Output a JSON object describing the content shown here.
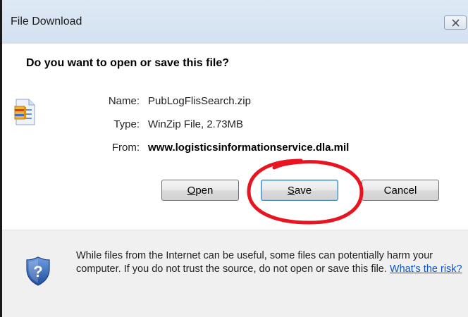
{
  "window": {
    "title": "File Download",
    "close_label": "close"
  },
  "dialog": {
    "question": "Do you want to open or save this file?",
    "file": {
      "icon": "winzip-file-icon",
      "name_label": "Name:",
      "name_value": "PubLogFlisSearch.zip",
      "type_label": "Type:",
      "type_value": "WinZip File, 2.73MB",
      "from_label": "From:",
      "from_value": "www.logisticsinformationservice.dla.mil"
    },
    "buttons": {
      "open_prefix": "",
      "open_underlined": "O",
      "open_rest": "pen",
      "save_prefix": "",
      "save_underlined": "S",
      "save_rest": "ave",
      "cancel_label": "Cancel"
    },
    "annotation": {
      "shape": "hand-drawn ellipse",
      "color": "#e8141f",
      "target": "Save"
    }
  },
  "footer": {
    "icon": "shield-question-icon",
    "warning_text": "While files from the Internet can be useful, some files can potentially harm your computer. If you do not trust the source, do not open or save this file.",
    "risk_link": "What's the risk?"
  },
  "colors": {
    "titlebar": "#d8e4f2",
    "footer_bg": "#f0f0f0",
    "link": "#0a56c8",
    "annotation": "#e8141f"
  }
}
